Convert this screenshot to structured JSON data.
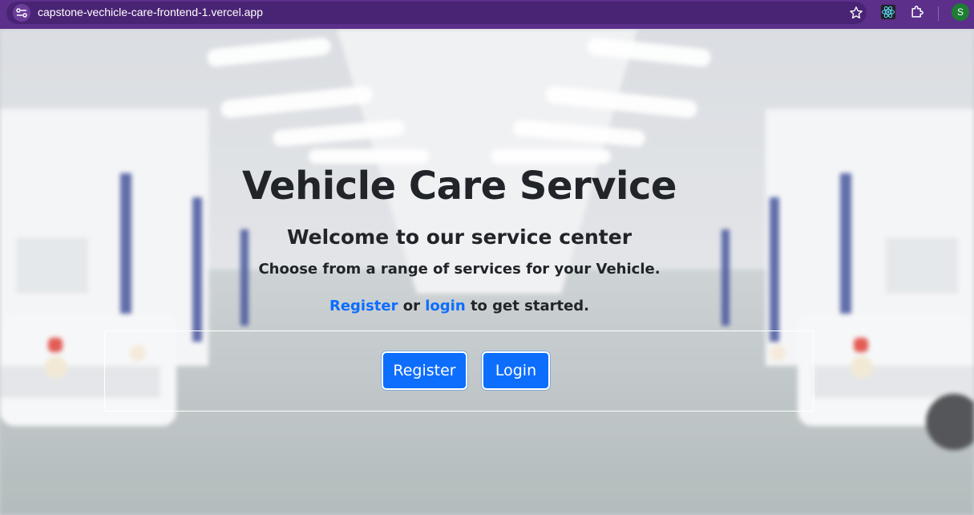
{
  "browser": {
    "url": "capstone-vechicle-care-frontend-1.vercel.app",
    "profile_initial": "S",
    "accent": "#5b2f8a"
  },
  "hero": {
    "title": "Vehicle Care Service",
    "subtitle": "Welcome to our service center",
    "tagline": "Choose from a range of services for your Vehicle.",
    "cta_register_link": "Register",
    "cta_or": " or ",
    "cta_login_link": "login",
    "cta_suffix": " to get started."
  },
  "buttons": {
    "register_label": "Register",
    "login_label": "Login",
    "color": "#0d6efd"
  },
  "icons": {
    "site_info": "tune-icon",
    "bookmark": "star-icon",
    "react_devtools": "react-icon",
    "extensions": "puzzle-icon"
  }
}
